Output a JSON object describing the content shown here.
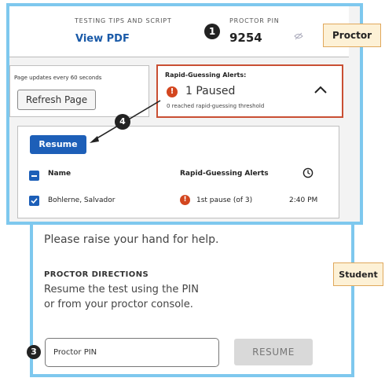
{
  "proctor": {
    "label": "Proctor",
    "tips_title": "TESTING TIPS AND SCRIPT",
    "view_pdf": "View PDF",
    "badge_1": "1",
    "pin_title": "PROCTOR PIN",
    "pin_value": "9254",
    "refresh_note": "Page updates every 60 seconds",
    "refresh_button": "Refresh Page",
    "alerts": {
      "title": "Rapid-Guessing Alerts:",
      "icon_text": "!",
      "paused": "1 Paused",
      "threshold": "0 reached rapid-guessing threshold"
    },
    "badge_4": "4",
    "resume_button": "Resume",
    "table": {
      "col_name": "Name",
      "col_alerts": "Rapid-Guessing Alerts",
      "rows": [
        {
          "name": "Bohlerne, Salvador",
          "alert_icon": "!",
          "alert": "1st pause (of 3)",
          "time": "2:40 PM"
        }
      ]
    },
    "icons": [
      "eye-off-icon",
      "chevron-up-icon",
      "clock-icon",
      "checkbox-icon",
      "minus-checkbox-icon"
    ],
    "colors": {
      "accent": "#1d5fb8",
      "alert": "#d3461f",
      "frame": "#7ec8ee",
      "label_bg": "#fdf1d6"
    }
  },
  "student": {
    "label": "Student",
    "help_text": "Please raise your hand for help.",
    "directions_title": "PROCTOR DIRECTIONS",
    "directions_line1": "Resume the test using the PIN",
    "directions_line2": "or from your proctor console.",
    "badge_3": "3",
    "pin_placeholder": "Proctor PIN",
    "resume_button": "RESUME"
  }
}
